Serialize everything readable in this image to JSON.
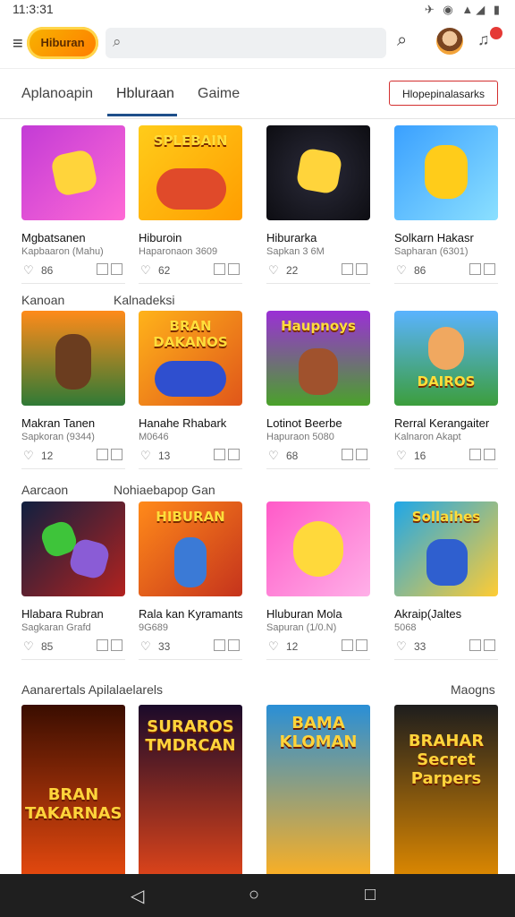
{
  "status": {
    "time": "11:3:31",
    "icons": "✈ ◉ ▲◢ ▮"
  },
  "appbar": {
    "logo": "Hiburan",
    "search_placeholder": "",
    "search_value": ""
  },
  "notifications": {
    "badge": ""
  },
  "tabs": [
    {
      "label": "Aplanoapin"
    },
    {
      "label": "Hbluraan"
    },
    {
      "label": "Gaime"
    }
  ],
  "tab_button": "Hlopepinalasarks",
  "sections": [
    {
      "title": "",
      "right": "",
      "cards": [
        {
          "title": "Mgbatsanen",
          "sub": "Kapbaaron (Mahu)",
          "count": "86",
          "banner": "",
          "colors": [
            "#c33bd6",
            "#ff6ad5"
          ]
        },
        {
          "title": "Hiburoin",
          "sub": "Haparonaon 3609",
          "count": "62",
          "banner": "SPLEBAIN",
          "colors": [
            "#ffcc1a",
            "#ff9d00"
          ]
        },
        {
          "title": "Hiburarka",
          "sub": "Sapkan 3 6M",
          "count": "22",
          "banner": "",
          "colors": [
            "#0d0d12",
            "#2b2b3a"
          ]
        },
        {
          "title": "Solkarn Hakasr",
          "sub": "Sapharan (6301)",
          "count": "86",
          "banner": "",
          "colors": [
            "#3aa0ff",
            "#8be0ff"
          ]
        }
      ]
    },
    {
      "title": "Kanoan",
      "title2": "Kalnadeksi",
      "right": "",
      "cards": [
        {
          "title": "Makran Tanen",
          "sub": "Sapkoran (9344)",
          "count": "12",
          "banner": "",
          "colors": [
            "#ff8b1a",
            "#2f7a36"
          ]
        },
        {
          "title": "Hanahe Rhabark",
          "sub": "M0646",
          "count": "13",
          "banner": "BRAN DAKANOS",
          "colors": [
            "#ffb31a",
            "#e0561a"
          ]
        },
        {
          "title": "Lotinot Beerbe",
          "sub": "Hapuraon 5080",
          "count": "68",
          "banner": "Haupnoys",
          "colors": [
            "#9b2fd6",
            "#4aa22a"
          ]
        },
        {
          "title": "Rerral Kerangaiter",
          "sub": "Kalnaron Akapt",
          "count": "16",
          "banner": "DAIROS",
          "colors": [
            "#5ab3ff",
            "#3c9e3c"
          ]
        }
      ]
    },
    {
      "title": "Aarcaon",
      "title2": "Nohiaebapop Gan",
      "right": "",
      "cards": [
        {
          "title": "Hlabara Rubran",
          "sub": "Sagkaran Grafd",
          "count": "85",
          "banner": "",
          "colors": [
            "#102040",
            "#b2221f"
          ]
        },
        {
          "title": "Rala kan Kyramants",
          "sub": "9G689",
          "count": "33",
          "banner": "HIBURAN",
          "colors": [
            "#ff8a1a",
            "#c5331c"
          ]
        },
        {
          "title": "Hluburan Mola",
          "sub": "Sapuran (1/0.N)",
          "count": "12",
          "banner": "",
          "colors": [
            "#ff5ac8",
            "#ffb0e8"
          ]
        },
        {
          "title": "Akraip(Jaltes",
          "sub": "5068",
          "count": "33",
          "banner": "Sollaihes",
          "colors": [
            "#1fa7e8",
            "#ffcc33"
          ]
        }
      ]
    },
    {
      "title": "Aanarertals Apilalaelarels",
      "right": "Maogns",
      "bigcards": [
        {
          "banner": "BRAN TAKARNAS",
          "colors": [
            "#3a0d00",
            "#e84a0f"
          ]
        },
        {
          "banner": "SURAROS TMDRCAN",
          "colors": [
            "#1a0a2a",
            "#e0451a"
          ]
        },
        {
          "banner": "BAMA KLOMAN",
          "colors": [
            "#2a8fd6",
            "#ffb020"
          ]
        },
        {
          "banner": "BRAHAR Secret Parpers",
          "colors": [
            "#1d1d1d",
            "#e08a00"
          ]
        }
      ]
    }
  ],
  "nav": {
    "back": "◁",
    "home": "○",
    "recents": "□"
  }
}
